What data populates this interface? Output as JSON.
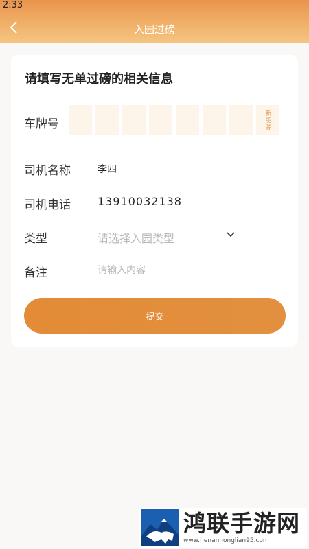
{
  "status_bar": {
    "time": "2:33"
  },
  "header": {
    "title": "入园过磅"
  },
  "form": {
    "title": "请填写无单过磅的相关信息",
    "plate": {
      "label": "车牌号",
      "new_energy_label": "新能源"
    },
    "driver_name": {
      "label": "司机名称",
      "value": "李四"
    },
    "driver_phone": {
      "label": "司机电话",
      "value": "13910032138"
    },
    "type": {
      "label": "类型",
      "placeholder": "请选择入园类型"
    },
    "remark": {
      "label": "备注",
      "placeholder": "请输入内容"
    },
    "submit_label": "提交"
  },
  "watermark": {
    "name": "鸿联手游网",
    "url": "www.henanhonglian95.com"
  }
}
